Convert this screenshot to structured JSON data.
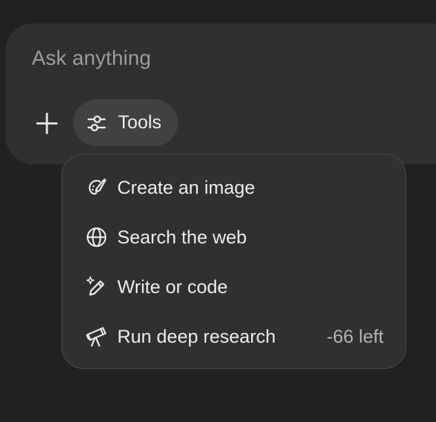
{
  "composer": {
    "placeholder": "Ask anything",
    "add_icon": "plus-icon",
    "tools_button": {
      "label": "Tools",
      "icon": "sliders-icon"
    }
  },
  "tools_menu": {
    "items": [
      {
        "label": "Create an image",
        "icon": "palette-brush-icon",
        "meta": ""
      },
      {
        "label": "Search the web",
        "icon": "globe-icon",
        "meta": ""
      },
      {
        "label": "Write or code",
        "icon": "sparkle-pen-icon",
        "meta": ""
      },
      {
        "label": "Run deep research",
        "icon": "telescope-icon",
        "meta": "-66 left"
      }
    ]
  },
  "colors": {
    "background": "#212121",
    "surface": "#303030",
    "tools_button_bg": "#414141",
    "menu_border": "#4b4b4b",
    "text": "#ececec",
    "placeholder_text": "#9b9b9b",
    "secondary_text": "#b4b4b4"
  }
}
